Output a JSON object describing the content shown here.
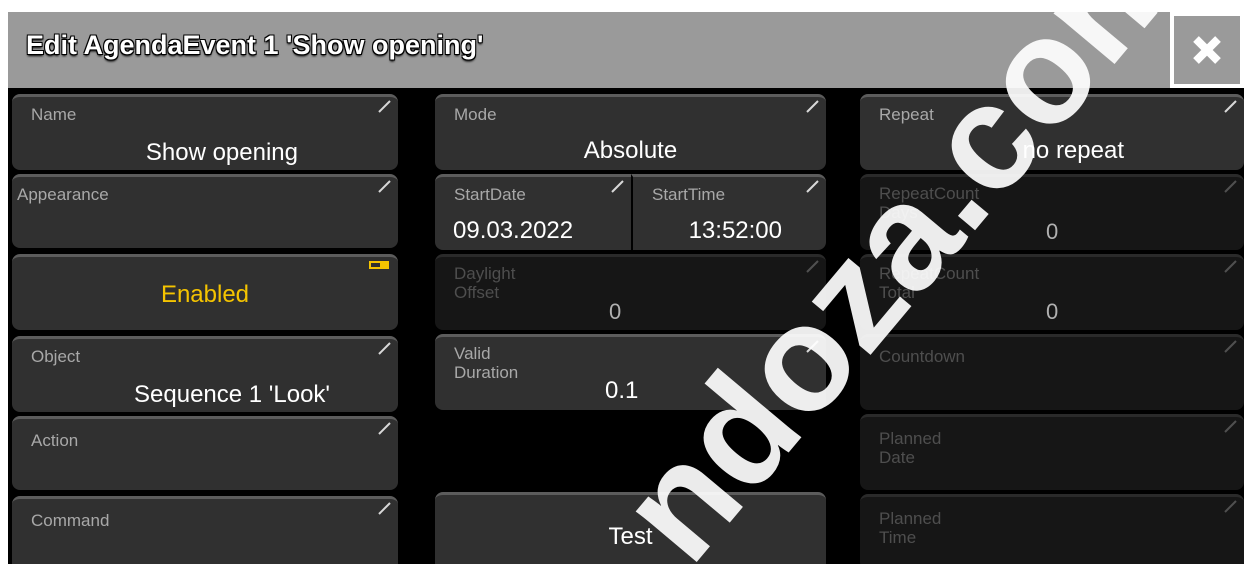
{
  "window": {
    "title": "Edit AgendaEvent 1 'Show opening'"
  },
  "left": {
    "name": {
      "label": "Name",
      "value": "Show opening"
    },
    "appearance": {
      "label": "Appearance"
    },
    "enabled": {
      "value": "Enabled"
    },
    "object": {
      "label": "Object",
      "value": "Sequence 1 'Look'"
    },
    "action": {
      "label": "Action"
    },
    "command": {
      "label": "Command"
    }
  },
  "middle": {
    "mode": {
      "label": "Mode",
      "value": "Absolute"
    },
    "start_date": {
      "label": "StartDate",
      "value": "09.03.2022"
    },
    "start_time": {
      "label": "StartTime",
      "value": "13:52:00"
    },
    "daylight_offset": {
      "label_line1": "Daylight",
      "label_line2": "Offset",
      "value": "0"
    },
    "valid_duration": {
      "label_line1": "Valid",
      "label_line2": "Duration",
      "value": "0.1"
    },
    "test": {
      "label": "Test"
    }
  },
  "right": {
    "repeat": {
      "label": "Repeat",
      "value": "no repeat"
    },
    "repeat_count_days": {
      "label_line1": "RepeatCount",
      "label_line2": "Days",
      "value": "0"
    },
    "repeat_count_total": {
      "label_line1": "RepeatCount",
      "label_line2": "Total",
      "value": "0"
    },
    "countdown": {
      "label": "Countdown"
    },
    "planned_date": {
      "label_line1": "Planned",
      "label_line2": "Date"
    },
    "planned_time": {
      "label_line1": "Planned",
      "label_line2": "Time"
    }
  },
  "colors": {
    "enabled_text": "#f5c400",
    "title_bar": "#9a9a9a",
    "button_bg": "#303030",
    "disabled_button_bg": "#161616"
  },
  "watermark": "ndoza.com",
  "icons": [
    "close-icon",
    "edit-corner-icon",
    "toggle-indicator-icon"
  ]
}
